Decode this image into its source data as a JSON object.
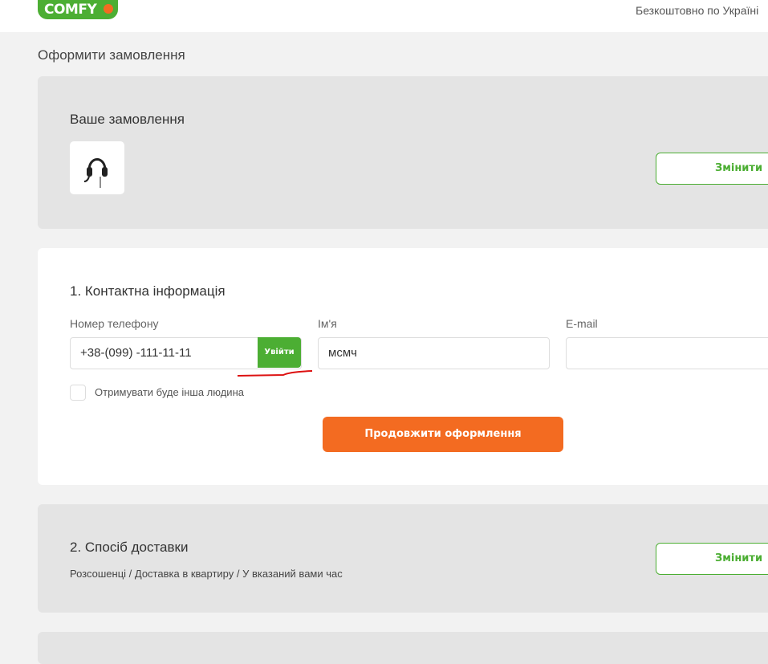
{
  "header": {
    "logo": "COMFY",
    "free_shipping": "Безкоштовно по Україні"
  },
  "page_title": "Оформити замовлення",
  "order": {
    "title": "Ваше замовлення",
    "change_label": "Змінити",
    "product_icon": "headset-icon"
  },
  "contact": {
    "title": "1. Контактна інформація",
    "phone_label": "Номер телефону",
    "phone_value": "+38-(099) -111-11-11",
    "login_label": "Увійти",
    "name_label": "Ім'я",
    "name_value": "мсмч",
    "email_label": "E-mail",
    "email_value": "",
    "other_person_label": "Отримувати буде інша людина",
    "continue_label": "Продовжити оформлення"
  },
  "delivery": {
    "title": "2. Спосіб доставки",
    "summary": "Розсошенці / Доставка в квартиру / У вказаний вами час",
    "change_label": "Змінити"
  },
  "colors": {
    "brand_green": "#4cae33",
    "accent_orange": "#f36b21",
    "annotation_red": "#d11"
  }
}
